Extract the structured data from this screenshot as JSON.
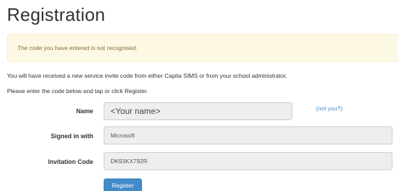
{
  "page": {
    "title": "Registration"
  },
  "alert": {
    "message": "The code you have entered is not recognised."
  },
  "intro": {
    "line1": "You will have received a new service invite code from either Capita SIMS or from your school administrator.",
    "line2": "Please enter the code below and tap or click Register."
  },
  "form": {
    "name_label": "Name",
    "name_value": "<Your name>",
    "not_you_link": "(not you?)",
    "signed_in_label": "Signed in with",
    "signed_in_value": "Microsoft",
    "code_label": "Invitation Code",
    "code_value": "DK93KX792R",
    "register_label": "Register"
  },
  "colors": {
    "alert_background": "#fcf8e3",
    "alert_text": "#8a6d3b",
    "link": "#428bca",
    "button": "#428bca",
    "field_background": "#eeeeee"
  }
}
